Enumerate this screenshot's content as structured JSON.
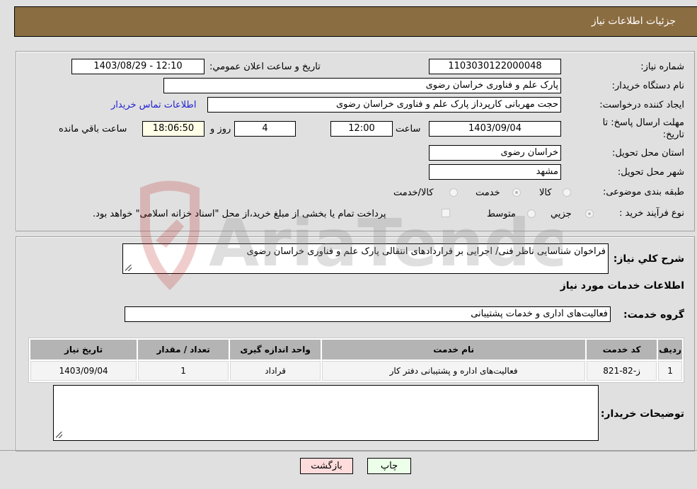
{
  "header": {
    "title": "جزئیات اطلاعات نیاز"
  },
  "details": {
    "need_number": {
      "label": "شماره نیاز:",
      "value": "1103030122000048"
    },
    "announce_datetime": {
      "label": "تاریخ و ساعت اعلان عمومي:",
      "value": "1403/08/29 - 12:10"
    },
    "buyer_org": {
      "label": "نام دستگاه خریدار:",
      "value": "پارک علم و فناوری خراسان رضوی"
    },
    "requester": {
      "label": "ایجاد کننده درخواست:",
      "value": "حجت مهربانی کارپرداز پارک علم و فناوری خراسان رضوی"
    },
    "buyer_contact_link": "اطلاعات تماس خریدار",
    "deadline": {
      "label": "مهلت ارسال پاسخ: تا تاریخ:",
      "date": "1403/09/04",
      "time_label": "ساعت",
      "time": "12:00",
      "days": "4",
      "days_label": "روز و",
      "remaining": "18:06:50",
      "remaining_label": "ساعت باقي مانده"
    },
    "province": {
      "label": "استان محل تحویل:",
      "value": "خراسان رضوی"
    },
    "city": {
      "label": "شهر محل تحویل:",
      "value": "مشهد"
    },
    "category": {
      "label": "طبقه بندی موضوعی:",
      "options": [
        "کالا",
        "خدمت",
        "کالا/خدمت"
      ],
      "selected": "خدمت"
    },
    "purchase_type": {
      "label": "نوع فرآیند خرید :",
      "options": [
        "جزيي",
        "متوسط"
      ],
      "selected": "جزيي",
      "treasury_note": "پرداخت تمام یا بخشی از مبلغ خرید،از محل \"اسناد خزانه اسلامی\" خواهد بود."
    }
  },
  "description": {
    "label": "شرح کلي نياز:",
    "value": "فراخوان شناسایی ناظر فنی/ اجرایی بر قراردادهای انتقالی پارک علم و فناوری خراسان رضوی"
  },
  "services_section_title": "اطلاعات خدمات مورد نياز",
  "service_group": {
    "label": "گروه خدمت:",
    "value": "فعالیت‌های اداری و خدمات پشتیبانی"
  },
  "table": {
    "headers": [
      "رديف",
      "کد خدمت",
      "نام خدمت",
      "واحد اندازه گیری",
      "تعداد / مقدار",
      "تاریخ نیاز"
    ],
    "rows": [
      [
        "1",
        "ز-82-821",
        "فعالیت‌های اداره و پشتیبانی دفتر کار",
        "قراداد",
        "1",
        "1403/09/04"
      ]
    ]
  },
  "buyer_notes": {
    "label": "توضیحات خریدار:",
    "value": ""
  },
  "buttons": {
    "print": "چاپ",
    "back": "بازگشت"
  },
  "watermark": "AriaTender.neT",
  "colors": {
    "header_bg": "#8b6d42",
    "link": "#2020d0",
    "print_bg": "#ecffe8",
    "back_bg": "#ffdcdc"
  }
}
